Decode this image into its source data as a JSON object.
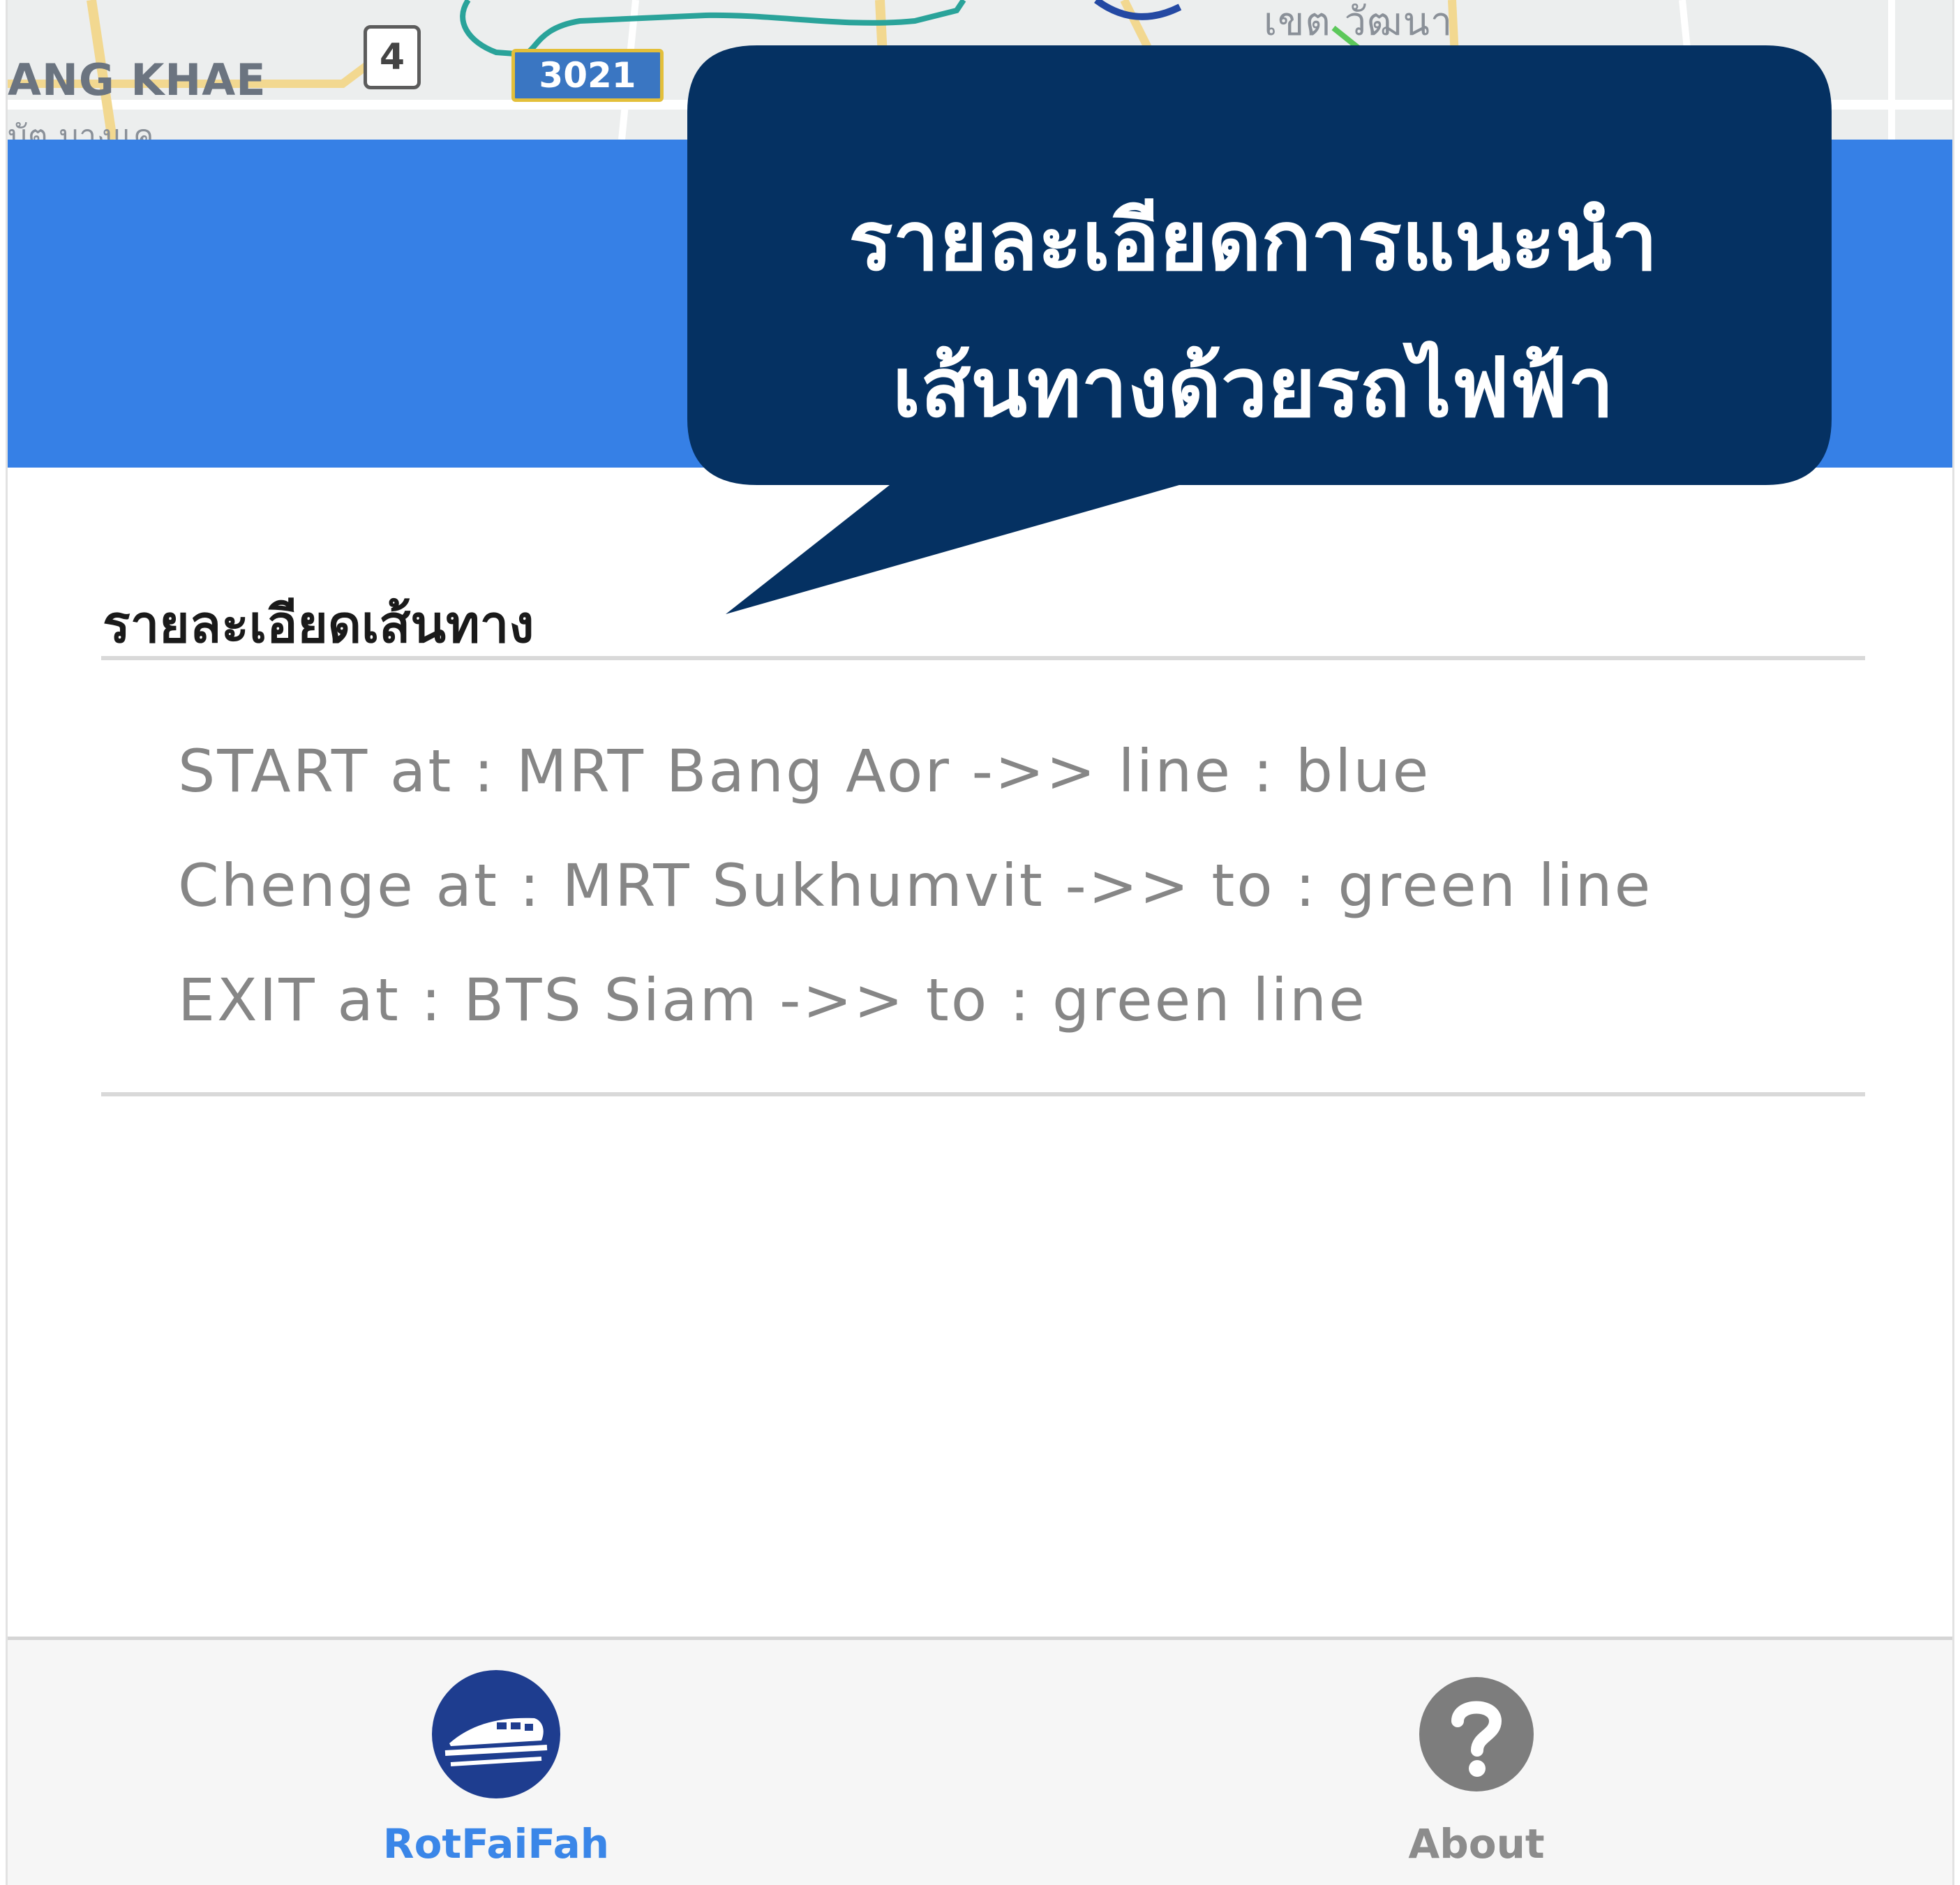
{
  "map": {
    "area_label": "ANG KHAE",
    "area_sublabel": "บัต บางแค",
    "thai_label": "เขต วัฒนา",
    "shield_number": "4",
    "road_number": "3021"
  },
  "callout": {
    "line1": "รายละเอียดการแนะนำ",
    "line2": "เส้นทางด้วยรถไฟฟ้า",
    "color": "#053162"
  },
  "details": {
    "title": "รายละเอียดเส้นทาง",
    "steps": [
      "START at : MRT Bang Aor ->> line : blue",
      "Chenge at : MRT Sukhumvit ->> to : green line",
      "EXIT at : BTS Siam ->> to : green line"
    ]
  },
  "tabs": {
    "home_label": "RotFaiFah",
    "about_label": "About",
    "active_color": "#3a86e8",
    "inactive_color": "#8c8c8c"
  },
  "colors": {
    "header_blue": "#3680e6"
  }
}
